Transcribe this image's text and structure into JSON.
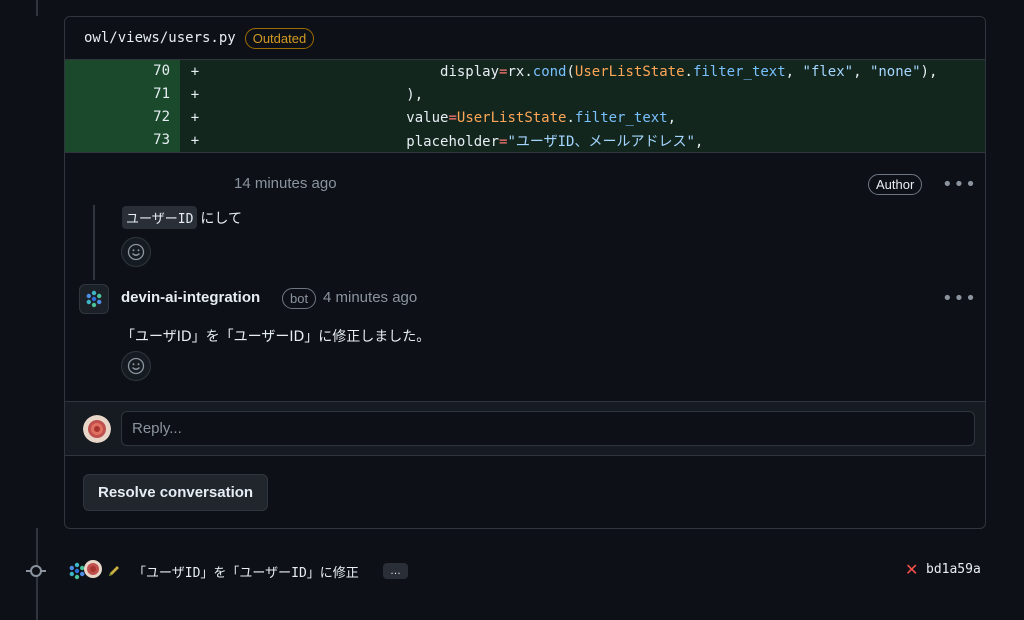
{
  "file": {
    "path": "owl/views/users.py",
    "badge": "Outdated"
  },
  "diff": {
    "lines": [
      {
        "num": "70",
        "sign": "+"
      },
      {
        "num": "71",
        "sign": "+"
      },
      {
        "num": "72",
        "sign": "+"
      },
      {
        "num": "73",
        "sign": "+"
      }
    ],
    "line70": {
      "indent": "                            ",
      "a": "display",
      "b": "=",
      "c": "rx.",
      "d": "cond",
      "e": "(",
      "f": "UserListState",
      "g": ".",
      "h": "filter_text",
      "i": ", ",
      "j": "\"flex\"",
      "k": ", ",
      "l": "\"none\"",
      "m": "),"
    },
    "line71": {
      "text": "                        ),"
    },
    "line72": {
      "indent": "                        ",
      "a": "value",
      "b": "=",
      "c": "UserListState",
      "d": ".",
      "e": "filter_text",
      "f": ","
    },
    "line73": {
      "indent": "                        ",
      "a": "placeholder",
      "b": "=",
      "c": "\"ユーザID、メールアドレス\"",
      "d": ","
    }
  },
  "comment1": {
    "time": "14 minutes ago",
    "author_badge": "Author",
    "code": "ユーザーID",
    "text": "にして",
    "more": "•••"
  },
  "comment2": {
    "author": "devin-ai-integration",
    "bot_badge": "bot",
    "time": "4 minutes ago",
    "text": "「ユーザID」を「ユーザーID」に修正しました。",
    "more": "•••"
  },
  "reply": {
    "placeholder": "Reply..."
  },
  "resolve": {
    "label": "Resolve conversation"
  },
  "commit": {
    "message": "「ユーザID」を「ユーザーID」に修正",
    "expand": "…",
    "status_icon": "x-icon",
    "status_color": "#f85149",
    "sha": "bd1a59a"
  }
}
